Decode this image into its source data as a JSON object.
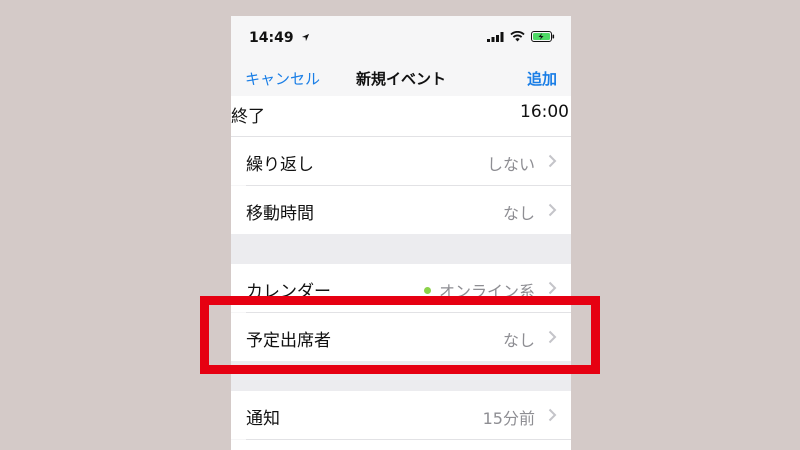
{
  "status_bar": {
    "time": "14:49"
  },
  "nav": {
    "cancel_label": "キャンセル",
    "title": "新規イベント",
    "add_label": "追加"
  },
  "rows": {
    "end": {
      "label": "終了",
      "value": "16:00"
    },
    "repeat": {
      "label": "繰り返し",
      "value": "しない"
    },
    "travel": {
      "label": "移動時間",
      "value": "なし"
    },
    "calendar": {
      "label": "カレンダー",
      "value": "オンライン系",
      "dot_color": "#8bd249"
    },
    "invitees": {
      "label": "予定出席者",
      "value": "なし"
    },
    "alert": {
      "label": "通知",
      "value": "15分前"
    }
  },
  "colors": {
    "accent": "#1a7ee6",
    "highlight": "#e60012",
    "battery": "#4cd964"
  },
  "icons": [
    "location-arrow-icon",
    "signal-icon",
    "wifi-icon",
    "battery-charging-icon",
    "chevron-right-icon"
  ]
}
